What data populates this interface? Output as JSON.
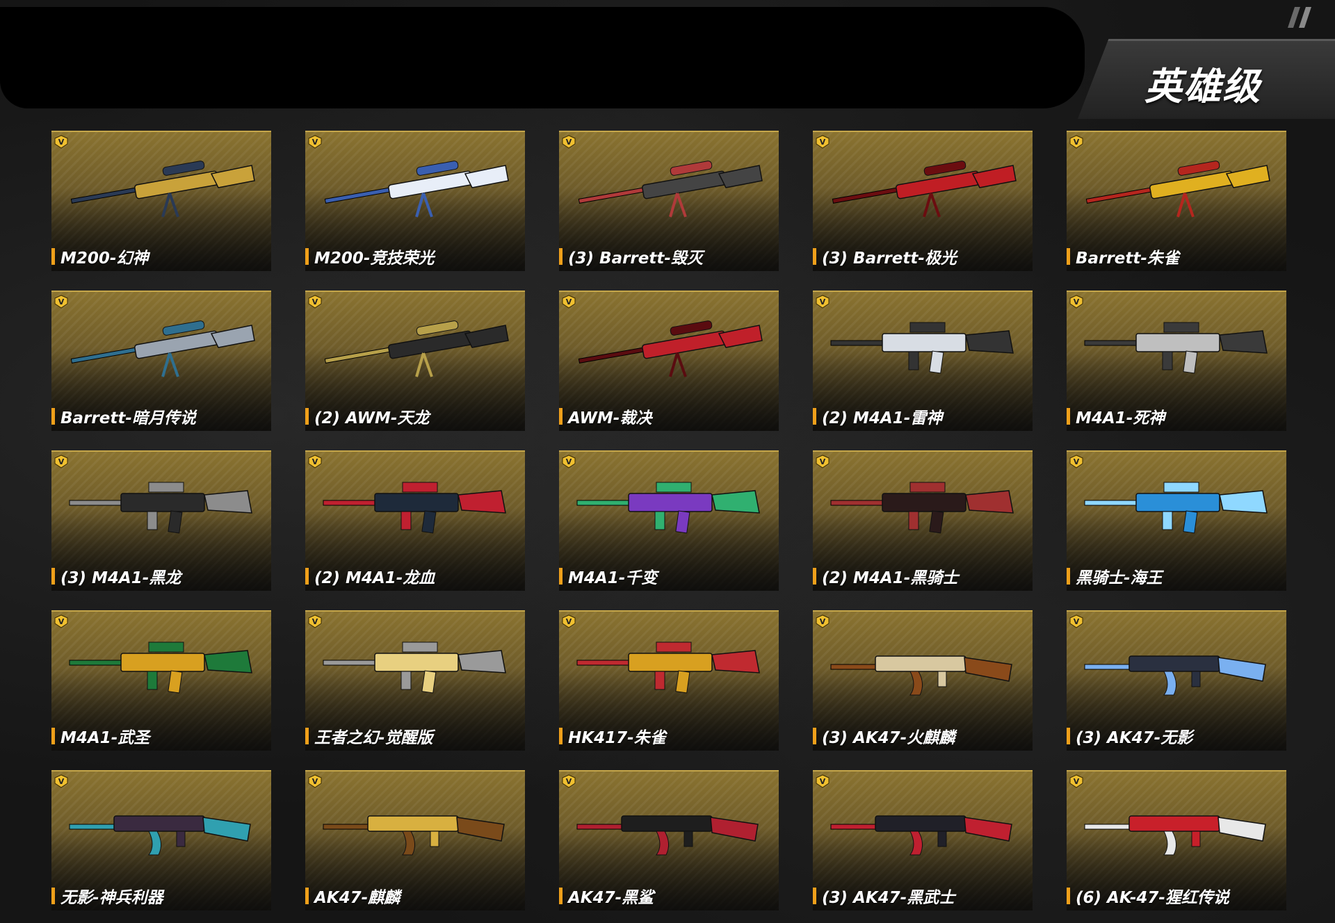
{
  "header": {
    "tier_title": "英雄级"
  },
  "theme": {
    "card_gold": "#8a7330",
    "label_accent": "#f0a01a",
    "label_text": "#ffffff"
  },
  "weapons": [
    {
      "name": "M200-幻神",
      "icon": "sniper-rifle-icon",
      "colors": [
        "#c9a23a",
        "#2a3a55"
      ]
    },
    {
      "name": "M200-竞技荣光",
      "icon": "sniper-rifle-icon",
      "colors": [
        "#e8eef8",
        "#3a5fb0"
      ]
    },
    {
      "name": "(3) Barrett-毁灭",
      "icon": "sniper-rifle-icon",
      "colors": [
        "#444444",
        "#b03a3a"
      ]
    },
    {
      "name": "(3) Barrett-极光",
      "icon": "sniper-rifle-icon",
      "colors": [
        "#c01e24",
        "#6b0d10"
      ]
    },
    {
      "name": "Barrett-朱雀",
      "icon": "sniper-rifle-icon",
      "colors": [
        "#e0b020",
        "#b5261e"
      ]
    },
    {
      "name": "Barrett-暗月传说",
      "icon": "sniper-rifle-icon",
      "colors": [
        "#9aa4b0",
        "#2f6f8f"
      ]
    },
    {
      "name": "(2) AWM-天龙",
      "icon": "sniper-rifle-icon",
      "colors": [
        "#2a2a2a",
        "#b7a04a"
      ]
    },
    {
      "name": "AWM-裁决",
      "icon": "sniper-rifle-icon",
      "colors": [
        "#c0202a",
        "#5a0c10"
      ]
    },
    {
      "name": "(2) M4A1-雷神",
      "icon": "assault-rifle-icon",
      "colors": [
        "#d8dde4",
        "#333333"
      ]
    },
    {
      "name": "M4A1-死神",
      "icon": "assault-rifle-icon",
      "colors": [
        "#bfbfbf",
        "#3a3a3a"
      ]
    },
    {
      "name": "(3) M4A1-黑龙",
      "icon": "assault-rifle-icon",
      "colors": [
        "#2a2a2a",
        "#8c8c8c"
      ]
    },
    {
      "name": "(2) M4A1-龙血",
      "icon": "assault-rifle-icon",
      "colors": [
        "#1e2a3a",
        "#c02030"
      ]
    },
    {
      "name": "M4A1-千变",
      "icon": "assault-rifle-icon",
      "colors": [
        "#7a3ac0",
        "#30b070"
      ]
    },
    {
      "name": "(2) M4A1-黑骑士",
      "icon": "assault-rifle-icon",
      "colors": [
        "#2a1a1a",
        "#a03030"
      ]
    },
    {
      "name": "黑骑士-海王",
      "icon": "assault-rifle-icon",
      "colors": [
        "#2a8fd8",
        "#8fd8ff"
      ]
    },
    {
      "name": "M4A1-武圣",
      "icon": "assault-rifle-icon",
      "colors": [
        "#d8a020",
        "#1e7a3a"
      ]
    },
    {
      "name": "王者之幻-觉醒版",
      "icon": "assault-rifle-icon",
      "colors": [
        "#e8d080",
        "#9a9a9a"
      ]
    },
    {
      "name": "HK417-朱雀",
      "icon": "assault-rifle-icon",
      "colors": [
        "#d8a020",
        "#c02a30"
      ]
    },
    {
      "name": "(3) AK47-火麒麟",
      "icon": "ak-rifle-icon",
      "colors": [
        "#d8c8a0",
        "#8a4a1a"
      ]
    },
    {
      "name": "(3) AK47-无影",
      "icon": "ak-rifle-icon",
      "colors": [
        "#2a3040",
        "#7ab0f0"
      ]
    },
    {
      "name": "无影-神兵利器",
      "icon": "ak-rifle-icon",
      "colors": [
        "#3a2a40",
        "#30a0b0"
      ]
    },
    {
      "name": "AK47-麒麟",
      "icon": "ak-rifle-icon",
      "colors": [
        "#d8b040",
        "#7a4a1a"
      ]
    },
    {
      "name": "AK47-黑鲨",
      "icon": "ak-rifle-icon",
      "colors": [
        "#1e1e1e",
        "#b02030"
      ]
    },
    {
      "name": "(3) AK47-黑武士",
      "icon": "ak-rifle-icon",
      "colors": [
        "#202028",
        "#c02030"
      ]
    },
    {
      "name": "(6) AK-47-猩红传说",
      "icon": "ak-rifle-icon",
      "colors": [
        "#c8202a",
        "#e8e8e8"
      ]
    }
  ]
}
